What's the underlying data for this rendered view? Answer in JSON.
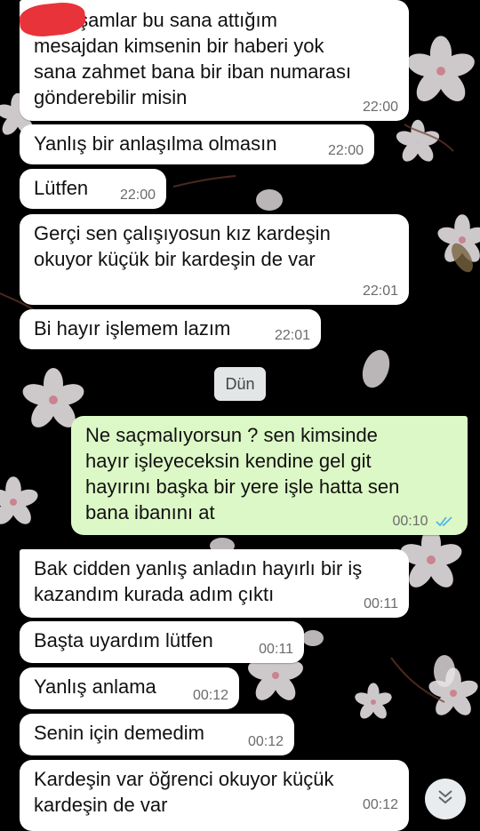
{
  "messages": [
    {
      "dir": "in",
      "text": "iyi akşamlar bu sana attığım\nmesajdan kimsenin bir haberi yok\nsana zahmet bana bir iban numarası\ngönderebilir misin",
      "time": "22:00"
    },
    {
      "dir": "in",
      "text": "Yanlış bir anlaşılma olmasın",
      "time": "22:00"
    },
    {
      "dir": "in",
      "text": "Lütfen",
      "time": "22:00"
    },
    {
      "dir": "in",
      "text": "Gerçi sen çalışıyosun kız kardeşin\nokuyor küçük bir kardeşin de var",
      "time": "22:01"
    },
    {
      "dir": "in",
      "text": "Bi hayır işlemem lazım",
      "time": "22:01"
    },
    {
      "dir": "out",
      "text": "Ne saçmalıyorsun ? sen kimsinde\nhayır işleyeceksin kendine gel git\nhayırını başka bir yere işle hatta sen\nbana ibanını at",
      "time": "00:10"
    },
    {
      "dir": "in",
      "text": "Bak cidden yanlış anladın hayırlı bir iş\nkazandım kurada adım çıktı",
      "time": "00:11"
    },
    {
      "dir": "in",
      "text": "Başta uyardım lütfen",
      "time": "00:11"
    },
    {
      "dir": "in",
      "text": "Yanlış anlama",
      "time": "00:12"
    },
    {
      "dir": "in",
      "text": "Senin için demedim",
      "time": "00:12"
    },
    {
      "dir": "in",
      "text": "Kardeşin var öğrenci okuyor küçük\nkardeşin de var",
      "time": "00:12"
    }
  ],
  "date_separator": "Dün",
  "colors": {
    "incoming": "#ffffff",
    "outgoing": "#dcf8c6",
    "read_ticks": "#4fb6ec",
    "background": "#000000"
  },
  "icons": {
    "read_receipt": "double-check-icon",
    "scroll_down": "chevron-double-down-icon",
    "redaction": "red-scribble"
  }
}
